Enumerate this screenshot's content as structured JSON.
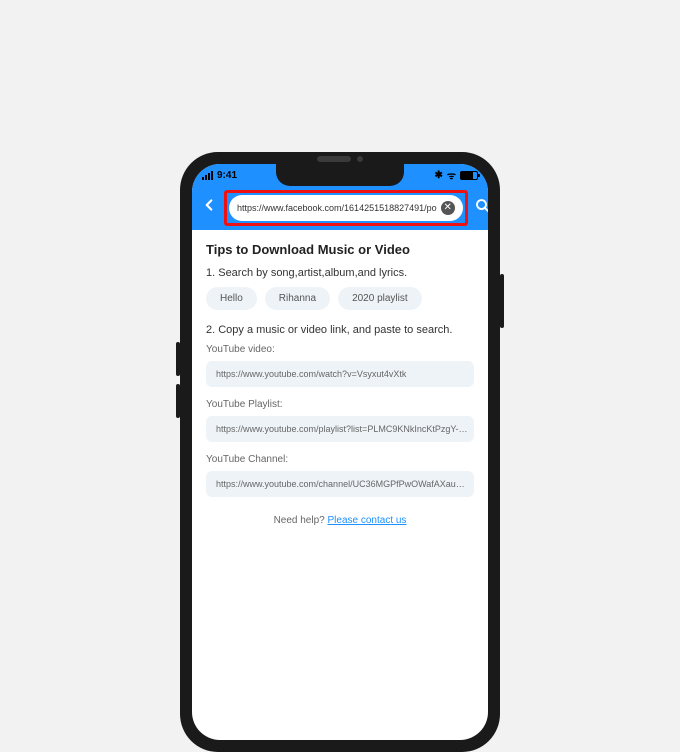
{
  "status": {
    "time": "9:41",
    "bluetooth_icon": "✱",
    "wifi_icon": "ᯤ"
  },
  "toolbar": {
    "url_value": "https://www.facebook.com/1614251518827491/po",
    "clear_label": "✕"
  },
  "page": {
    "title": "Tips to Download Music or Video",
    "step1": "1. Search by song,artist,album,and lyrics.",
    "chips": [
      "Hello",
      "Rihanna",
      "2020 playlist"
    ],
    "step2": "2. Copy a music or video link, and paste to search.",
    "examples": [
      {
        "label": "YouTube video:",
        "url": "https://www.youtube.com/watch?v=Vsyxut4vXtk"
      },
      {
        "label": "YouTube Playlist:",
        "url": "https://www.youtube.com/playlist?list=PLMC9KNkIncKtPzgY-…"
      },
      {
        "label": "YouTube Channel:",
        "url": "https://www.youtube.com/channel/UC36MGPfPwOWafAXau…"
      }
    ],
    "help_prefix": "Need help? ",
    "help_link": "Please contact us"
  }
}
